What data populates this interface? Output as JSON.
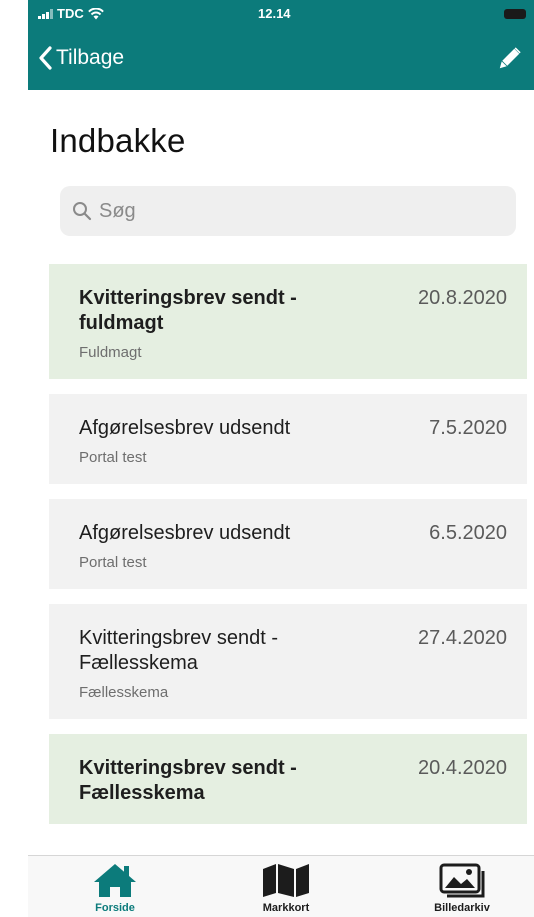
{
  "status_bar": {
    "carrier": "TDC",
    "time": "12.14"
  },
  "nav": {
    "back_label": "Tilbage"
  },
  "page": {
    "title": "Indbakke"
  },
  "search": {
    "placeholder": "Søg"
  },
  "messages": [
    {
      "subject": "Kvitteringsbrev sendt - fuldmagt",
      "date": "20.8.2020",
      "category": "Fuldmagt",
      "unread": true
    },
    {
      "subject": "Afgørelsesbrev udsendt",
      "date": "7.5.2020",
      "category": "Portal test",
      "unread": false
    },
    {
      "subject": "Afgørelsesbrev udsendt",
      "date": "6.5.2020",
      "category": "Portal test",
      "unread": false
    },
    {
      "subject": "Kvitteringsbrev sendt - Fællesskema",
      "date": "27.4.2020",
      "category": "Fællesskema",
      "unread": false
    },
    {
      "subject": "Kvitteringsbrev sendt - Fællesskema",
      "date": "20.4.2020",
      "category": "",
      "unread": true
    }
  ],
  "tabs": [
    {
      "label": "Forside",
      "icon": "home-icon",
      "active": true
    },
    {
      "label": "Markkort",
      "icon": "map-icon",
      "active": false
    },
    {
      "label": "Billedarkiv",
      "icon": "photo-archive-icon",
      "active": false
    }
  ],
  "colors": {
    "accent": "#0c7b7b",
    "unread_background": "#e5efe1",
    "read_background": "#f2f2f2"
  }
}
